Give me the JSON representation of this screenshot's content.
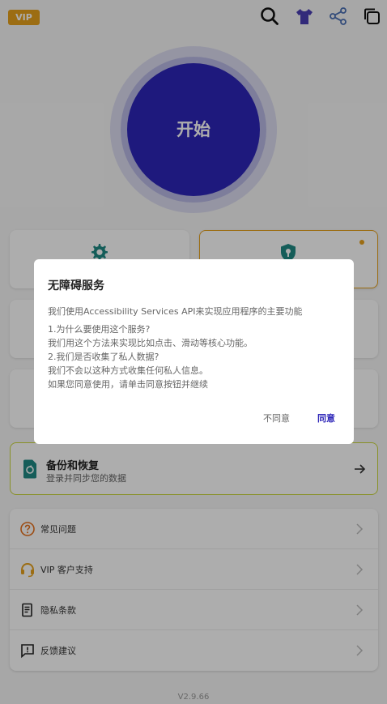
{
  "top_bar": {
    "vip_label": "VIP",
    "icons": [
      "search-icon",
      "tshirt-icon",
      "share-icon",
      "copy-icon"
    ]
  },
  "start_button": {
    "label": "开始"
  },
  "backup": {
    "title": "备份和恢复",
    "subtitle": "登录并同步您的数据"
  },
  "menu": {
    "items": [
      {
        "label": "常见问题",
        "icon": "question-icon"
      },
      {
        "label": "VIP 客户支持",
        "icon": "headset-icon"
      },
      {
        "label": "隐私条款",
        "icon": "document-icon"
      },
      {
        "label": "反馈建议",
        "icon": "feedback-icon"
      }
    ]
  },
  "version": "V2.9.66",
  "dialog": {
    "title": "无障碍服务",
    "intro": "我们使用Accessibility Services API来实现应用程序的主要功能",
    "lines": [
      "1.为什么要使用这个服务?",
      "我们用这个方法来实现比如点击、滑动等核心功能。",
      "2.我们是否收集了私人数据?",
      "我们不会以这种方式收集任何私人信息。",
      "如果您同意使用，请单击同意按钮并继续"
    ],
    "decline_label": "不同意",
    "accept_label": "同意"
  },
  "colors": {
    "accent": "#2d25b8",
    "vip": "#e6a11d",
    "teal_icon": "#1f8a84",
    "overlay": "rgba(0,0,0,0.32)"
  }
}
